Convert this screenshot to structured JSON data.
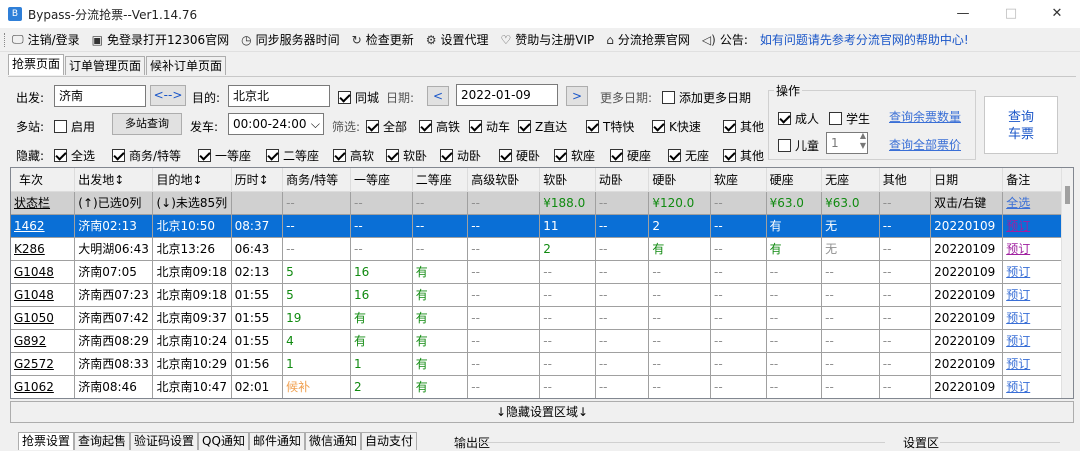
{
  "window": {
    "title": "Bypass-分流抢票--Ver1.14.76",
    "minimize": "—",
    "maximize": "□",
    "close": "✕"
  },
  "menu": [
    {
      "icon": "monitor-icon",
      "glyph": "🖵",
      "label": "注销/登录"
    },
    {
      "icon": "browser-icon",
      "glyph": "▣",
      "label": "免登录打开12306官网"
    },
    {
      "icon": "clock-icon",
      "glyph": "◷",
      "label": "同步服务器时间"
    },
    {
      "icon": "refresh-icon",
      "glyph": "↻",
      "label": "检查更新"
    },
    {
      "icon": "gear-icon",
      "glyph": "⚙",
      "label": "设置代理"
    },
    {
      "icon": "heart-icon",
      "glyph": "♡",
      "label": "赞助与注册VIP"
    },
    {
      "icon": "home-icon",
      "glyph": "⌂",
      "label": "分流抢票官网"
    },
    {
      "icon": "speaker-icon",
      "glyph": "◁)",
      "label": "公告:"
    }
  ],
  "notice": "如有问题请先参考分流官网的帮助中心!",
  "tabs": [
    "抢票页面",
    "订单管理页面",
    "候补订单页面"
  ],
  "form": {
    "from_label": "出发:",
    "from_value": "济南",
    "swap": "<-->",
    "to_label": "目的:",
    "to_value": "北京北",
    "samecity": "同城",
    "date_label": "日期:",
    "date_value": "2022-01-09",
    "prev": "<",
    "next": ">",
    "more_dates_label": "更多日期:",
    "add_more_dates": "添加更多日期",
    "multistation_label": "多站:",
    "enable": "启用",
    "multistation_query": "多站查询",
    "depart_label": "发车:",
    "depart_value": "00:00-24:00",
    "filter_label": "筛选:",
    "filters": [
      "全部",
      "高铁",
      "动车",
      "Z直达",
      "T特快",
      "K快速",
      "其他"
    ],
    "hide_label": "隐藏:",
    "hides": [
      "全选",
      "商务/特等",
      "一等座",
      "二等座",
      "高软",
      "软卧",
      "动卧",
      "硬卧",
      "软座",
      "硬座",
      "无座",
      "其他"
    ]
  },
  "ops": {
    "title": "操作",
    "adult": "成人",
    "student": "学生",
    "child": "儿童",
    "child_count": "1",
    "query_remaining": "查询余票数量",
    "query_all_prices": "查询全部票价",
    "query_button_1": "查询",
    "query_button_2": "车票"
  },
  "table": {
    "headers": [
      "车次",
      "出发地↕",
      "目的地↕",
      "历时↕",
      "商务/特等",
      "一等座",
      "二等座",
      "高级软卧",
      "软卧",
      "动卧",
      "硬卧",
      "软座",
      "硬座",
      "无座",
      "其他",
      "日期",
      "备注"
    ],
    "status_row": [
      "状态栏",
      "(↑)已选0列",
      "(↓)未选85列",
      "",
      "--",
      "--",
      "--",
      "--",
      "¥188.0",
      "--",
      "¥120.0",
      "--",
      "¥63.0",
      "¥63.0",
      "--",
      "双击/右键",
      "全选"
    ],
    "rows": [
      [
        "1462",
        "济南02:13",
        "北京10:50",
        "08:37",
        "--",
        "--",
        "--",
        "--",
        "11",
        "--",
        "2",
        "--",
        "有",
        "无",
        "--",
        "20220109",
        "预订"
      ],
      [
        "K286",
        "大明湖06:43",
        "北京13:26",
        "06:43",
        "--",
        "--",
        "--",
        "--",
        "2",
        "--",
        "有",
        "--",
        "有",
        "无",
        "--",
        "20220109",
        "预订"
      ],
      [
        "G1048",
        "济南07:05",
        "北京南09:18",
        "02:13",
        "5",
        "16",
        "有",
        "--",
        "--",
        "--",
        "--",
        "--",
        "--",
        "--",
        "--",
        "20220109",
        "预订"
      ],
      [
        "G1048",
        "济南西07:23",
        "北京南09:18",
        "01:55",
        "5",
        "16",
        "有",
        "--",
        "--",
        "--",
        "--",
        "--",
        "--",
        "--",
        "--",
        "20220109",
        "预订"
      ],
      [
        "G1050",
        "济南西07:42",
        "北京南09:37",
        "01:55",
        "19",
        "有",
        "有",
        "--",
        "--",
        "--",
        "--",
        "--",
        "--",
        "--",
        "--",
        "20220109",
        "预订"
      ],
      [
        "G892",
        "济南西08:29",
        "北京南10:24",
        "01:55",
        "4",
        "有",
        "有",
        "--",
        "--",
        "--",
        "--",
        "--",
        "--",
        "--",
        "--",
        "20220109",
        "预订"
      ],
      [
        "G2572",
        "济南西08:33",
        "北京南10:29",
        "01:56",
        "1",
        "1",
        "有",
        "--",
        "--",
        "--",
        "--",
        "--",
        "--",
        "--",
        "--",
        "20220109",
        "预订"
      ],
      [
        "G1062",
        "济南08:46",
        "北京南10:47",
        "02:01",
        "候补",
        "2",
        "有",
        "--",
        "--",
        "--",
        "--",
        "--",
        "--",
        "--",
        "--",
        "20220109",
        "预订"
      ]
    ]
  },
  "hide_settings": "↓隐藏设置区域↓",
  "bottom_tabs": [
    "抢票设置",
    "查询起售",
    "验证码设置",
    "QQ通知",
    "邮件通知",
    "微信通知",
    "自动支付"
  ],
  "output_area": "输出区",
  "settings_area": "设置区",
  "colors": {
    "selected_row": "#0a6fd6",
    "available_green": "#108a10",
    "link_blue": "#3a6fd6",
    "notice_blue": "#1a56c8"
  }
}
